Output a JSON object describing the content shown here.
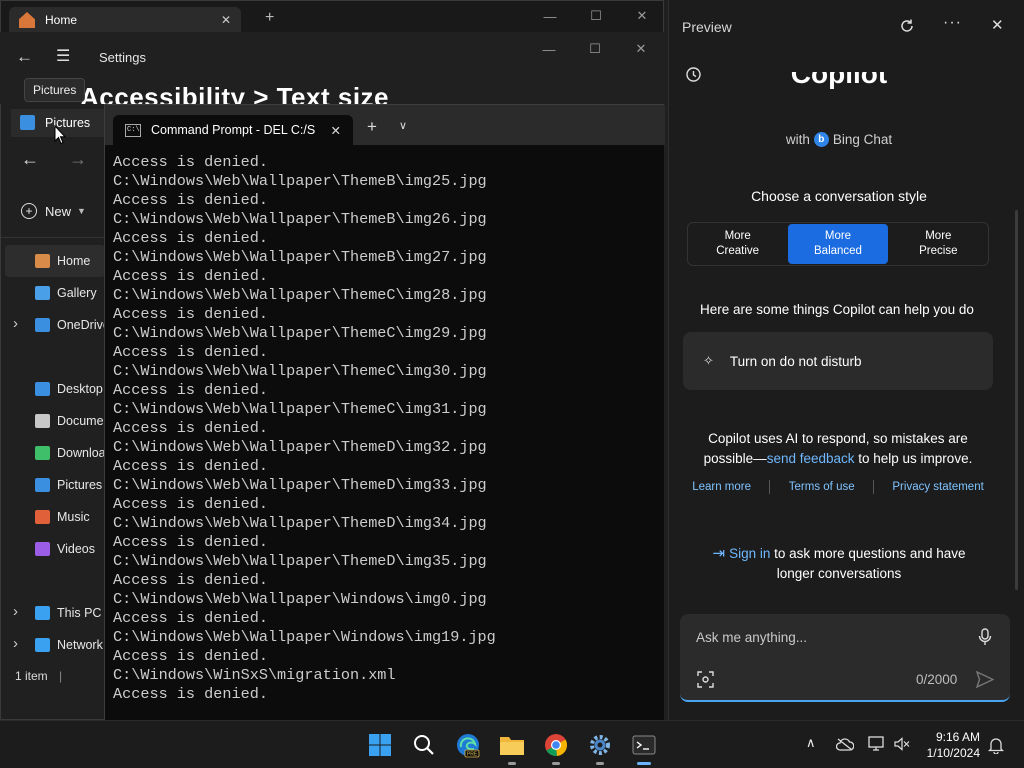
{
  "explorer": {
    "tab_title": "Home",
    "tooltip": "Pictures",
    "pictures_tab": "Pictures",
    "new_label": "New",
    "nav": [
      {
        "label": "Home",
        "icon": "home-icon",
        "active": true
      },
      {
        "label": "Gallery",
        "icon": "gallery-icon"
      },
      {
        "label": "OneDrive",
        "icon": "onedrive-icon",
        "expand": true
      },
      {
        "label": "Desktop",
        "icon": "desktop-icon"
      },
      {
        "label": "Documents",
        "icon": "documents-icon"
      },
      {
        "label": "Downloads",
        "icon": "downloads-icon"
      },
      {
        "label": "Pictures",
        "icon": "pictures-icon"
      },
      {
        "label": "Music",
        "icon": "music-icon"
      },
      {
        "label": "Videos",
        "icon": "videos-icon"
      },
      {
        "label": "This PC",
        "icon": "this-pc-icon",
        "expand": true
      },
      {
        "label": "Network",
        "icon": "network-icon",
        "expand": true
      }
    ],
    "status": "1 item"
  },
  "settings": {
    "title": "Settings",
    "heading": "Accessibility  >  Text size"
  },
  "cmd": {
    "tab_title": "Command Prompt - DEL  C:/S",
    "lines": [
      "Access is denied.",
      "C:\\Windows\\Web\\Wallpaper\\ThemeB\\img25.jpg",
      "Access is denied.",
      "C:\\Windows\\Web\\Wallpaper\\ThemeB\\img26.jpg",
      "Access is denied.",
      "C:\\Windows\\Web\\Wallpaper\\ThemeB\\img27.jpg",
      "Access is denied.",
      "C:\\Windows\\Web\\Wallpaper\\ThemeC\\img28.jpg",
      "Access is denied.",
      "C:\\Windows\\Web\\Wallpaper\\ThemeC\\img29.jpg",
      "Access is denied.",
      "C:\\Windows\\Web\\Wallpaper\\ThemeC\\img30.jpg",
      "Access is denied.",
      "C:\\Windows\\Web\\Wallpaper\\ThemeC\\img31.jpg",
      "Access is denied.",
      "C:\\Windows\\Web\\Wallpaper\\ThemeD\\img32.jpg",
      "Access is denied.",
      "C:\\Windows\\Web\\Wallpaper\\ThemeD\\img33.jpg",
      "Access is denied.",
      "C:\\Windows\\Web\\Wallpaper\\ThemeD\\img34.jpg",
      "Access is denied.",
      "C:\\Windows\\Web\\Wallpaper\\ThemeD\\img35.jpg",
      "Access is denied.",
      "C:\\Windows\\Web\\Wallpaper\\Windows\\img0.jpg",
      "Access is denied.",
      "C:\\Windows\\Web\\Wallpaper\\Windows\\img19.jpg",
      "Access is denied.",
      "C:\\Windows\\WinSxS\\migration.xml",
      "Access is denied."
    ]
  },
  "copilot": {
    "pane_title": "Preview",
    "logo": "Copilot",
    "with_prefix": "with",
    "with_brand": "Bing Chat",
    "style_title": "Choose a conversation style",
    "styles": [
      {
        "label": "More\nCreative",
        "selected": false
      },
      {
        "label": "More\nBalanced",
        "selected": true
      },
      {
        "label": "More\nPrecise",
        "selected": false
      }
    ],
    "help_text": "Here are some things Copilot can help you do",
    "suggestion": "Turn on do not disturb",
    "disclaimer_1": "Copilot uses AI to respond, so mistakes are possible—",
    "disclaimer_link": "send feedback",
    "disclaimer_2": " to help us improve.",
    "links": [
      "Learn more",
      "Terms of use",
      "Privacy statement"
    ],
    "signin_link": "Sign in",
    "signin_rest": " to ask more questions and have longer conversations",
    "input_placeholder": "Ask me anything...",
    "char_count": "0/2000"
  },
  "taskbar": {
    "apps": [
      "start-icon",
      "search-icon",
      "edge-beta-icon",
      "file-explorer-icon",
      "chrome-icon",
      "settings-icon",
      "terminal-icon"
    ],
    "time": "9:16 AM",
    "date": "1/10/2024"
  },
  "colors": {
    "accent": "#1b6ce0",
    "link": "#6fb8ff",
    "terminal_bg": "#0c0c0c"
  }
}
